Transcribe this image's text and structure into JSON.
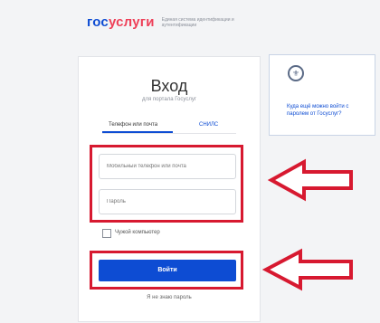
{
  "header": {
    "logo_part1": "гос",
    "logo_part2": "услуги",
    "logo_subtitle": "Единая система идентификации и аутентификации"
  },
  "login_form": {
    "title": "Вход",
    "subtitle": "для портала Госуслуг",
    "tabs": [
      {
        "label": "Телефон или почта",
        "active": true
      },
      {
        "label": "СНИЛС",
        "active": false
      }
    ],
    "phone_placeholder": "Мобильный телефон или почта",
    "password_placeholder": "Пароль",
    "remember_label": "Чужой компьютер",
    "login_button": "Войти",
    "forgot_link": "Я не знаю пароль"
  },
  "side_panel": {
    "icon": "emblem-icon",
    "text": "Куда ещё можно войти с паролем от Госуслуг?"
  },
  "colors": {
    "brand_blue": "#0d4cd3",
    "brand_red": "#ee3f58",
    "highlight_red": "#d71930"
  }
}
